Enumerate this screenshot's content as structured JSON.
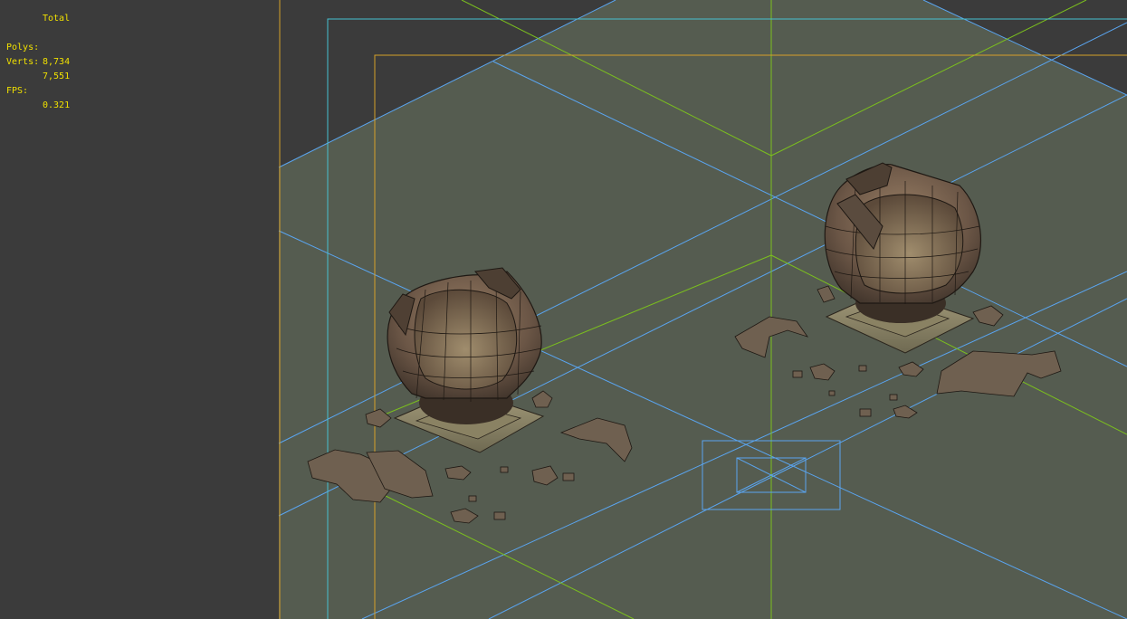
{
  "stats": {
    "total_label": "Total",
    "polys_label": "Polys:",
    "polys_value": "8,734",
    "verts_label": "Verts:",
    "verts_value": "7,551",
    "fps_label": "FPS:",
    "fps_value": "0.321"
  },
  "colors": {
    "viewport_bg": "#3b3b3b",
    "ground": "#555c50",
    "stats_text": "#f0e000",
    "grid_blue": "#5aa5f0",
    "axis_green": "#7bbf1e",
    "safe_frame_yellow": "#d6a02a",
    "safe_frame_cyan": "#46c0d0"
  },
  "scene": {
    "objects": [
      "broken-pot-left",
      "broken-pot-right",
      "pottery-shards-left",
      "pottery-shards-right",
      "camera-icon"
    ]
  }
}
